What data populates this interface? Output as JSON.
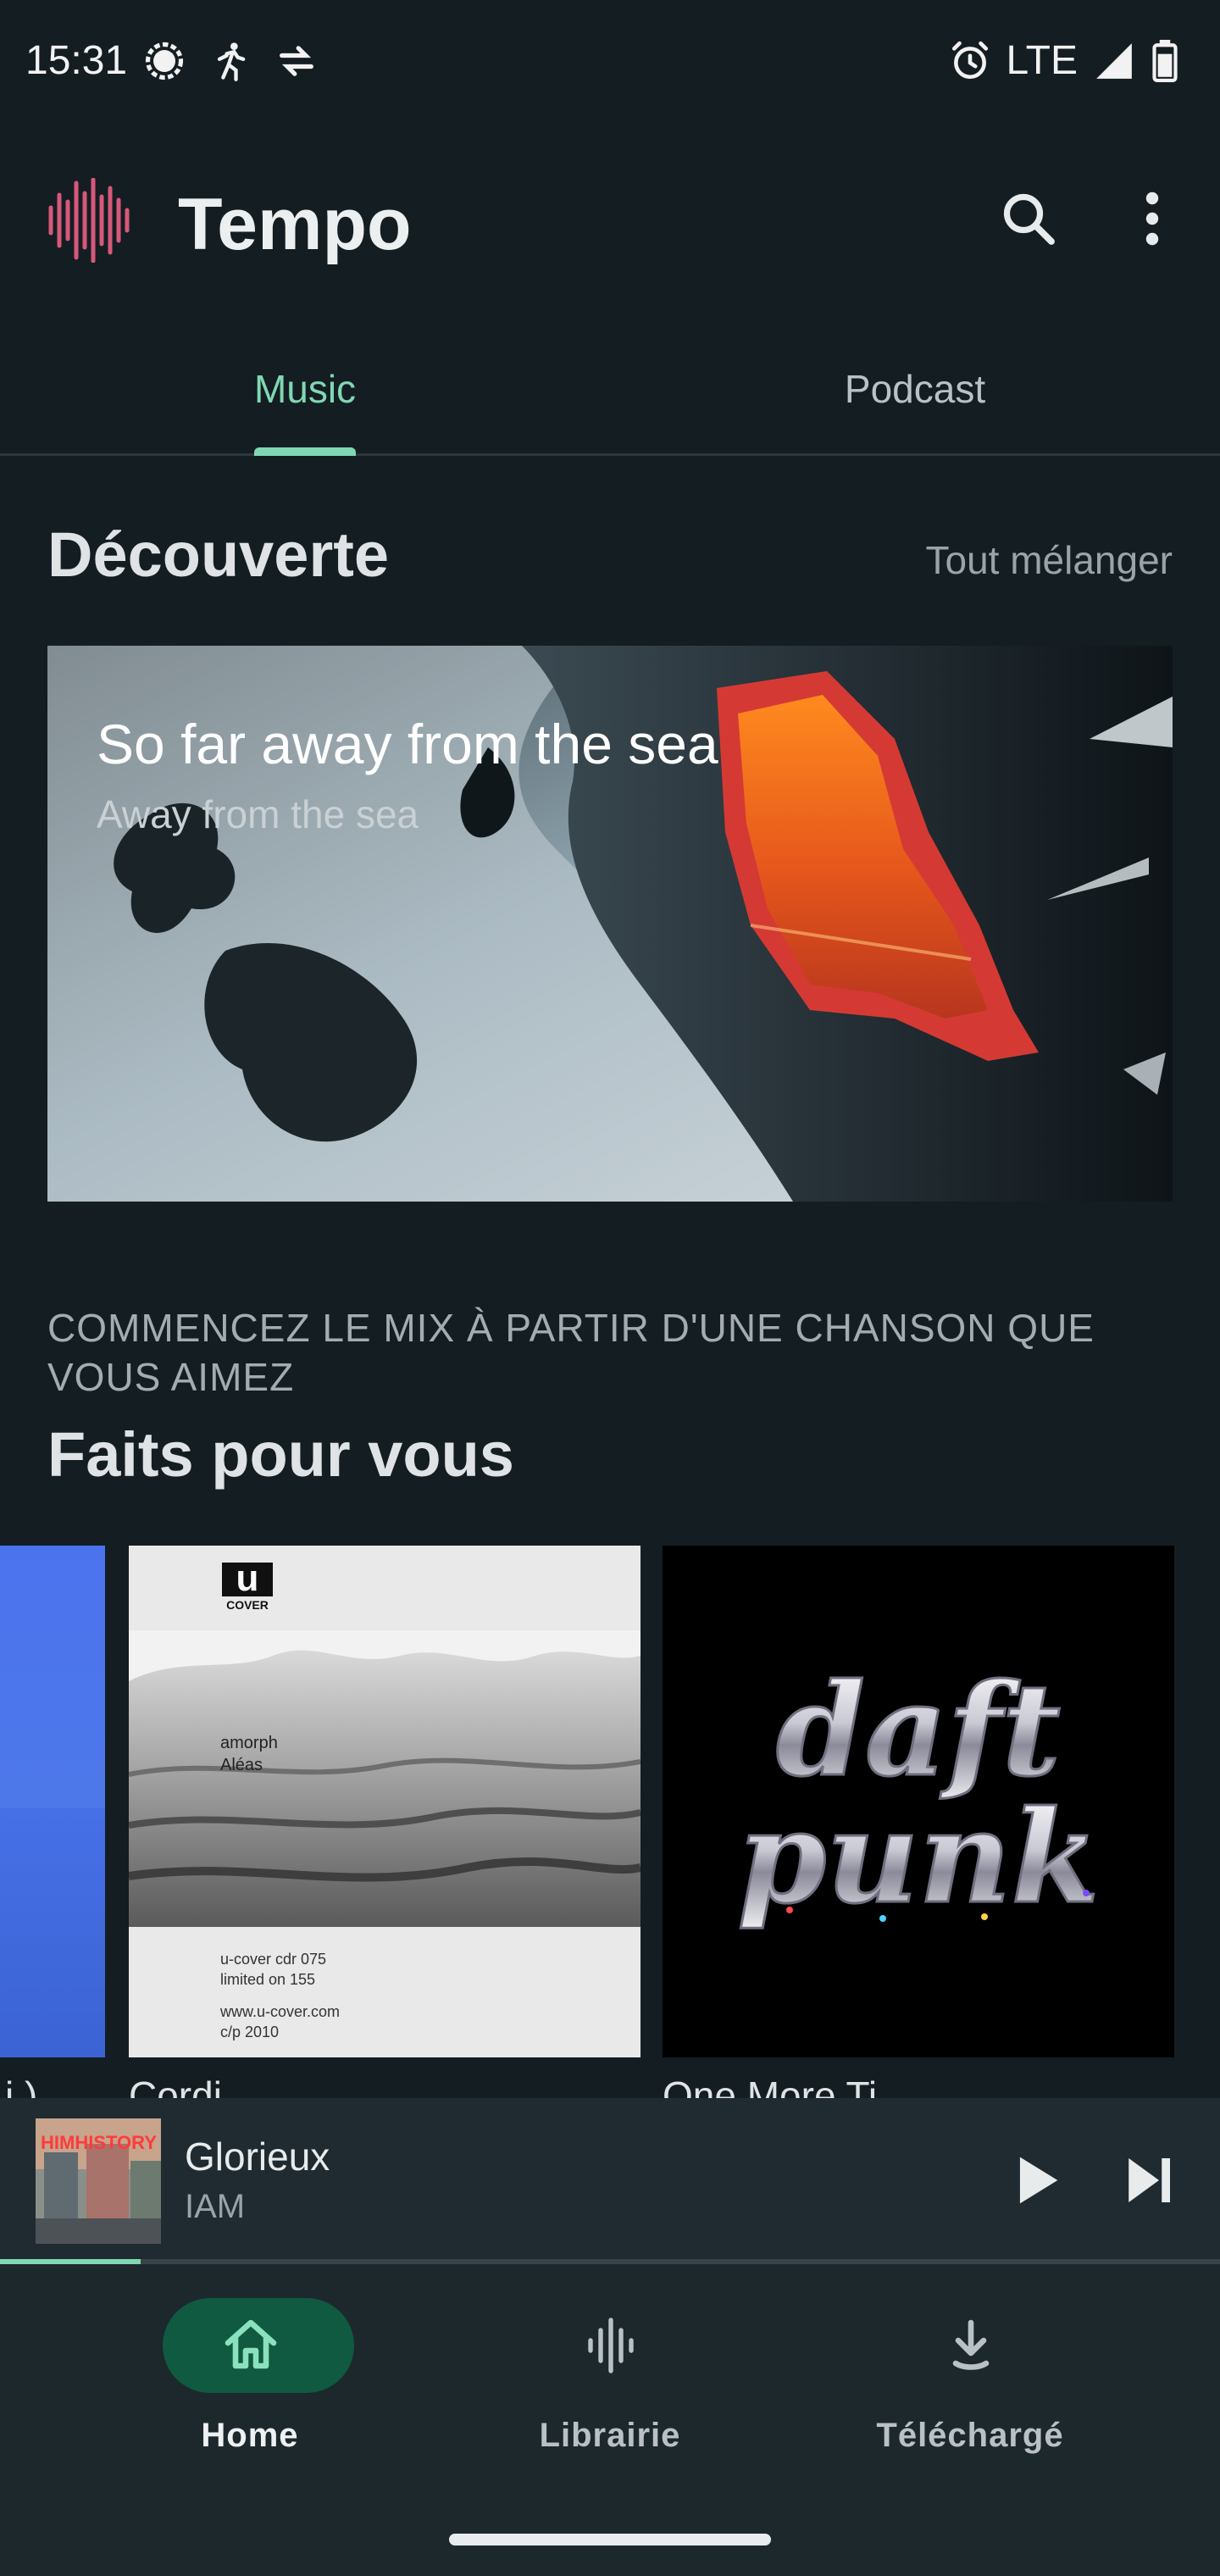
{
  "status_bar": {
    "time": "15:31",
    "network": "LTE",
    "icons": [
      "chat-bubble-icon",
      "running-icon",
      "data-transfer-icon",
      "alarm-icon",
      "signal-icon",
      "battery-icon"
    ]
  },
  "app_bar": {
    "title": "Tempo",
    "logo": "waveform-logo",
    "actions": [
      "search-icon",
      "more-vert-icon"
    ]
  },
  "tabs": [
    {
      "label": "Music",
      "selected": true
    },
    {
      "label": "Podcast",
      "selected": false
    }
  ],
  "discovery": {
    "title": "Découverte",
    "shuffle_label": "Tout mélanger",
    "featured": {
      "title": "So far away from the sea",
      "subtitle": "Away from the sea"
    }
  },
  "made_for_you": {
    "caption": "COMMENCEZ LE MIX À PARTIR D'UNE CHANSON QUE VOUS AIMEZ",
    "title": "Faits pour vous",
    "albums": [
      {
        "cover": "blue-gradient",
        "label": "i )"
      },
      {
        "cover": "u-cover",
        "label": "Cordi",
        "cover_text": {
          "brand": "u",
          "brand_sub": "COVER",
          "artist": "amorph",
          "album": "Aléas",
          "catalog": "u-cover cdr 075",
          "limited": "limited on 155",
          "site": "www.u-cover.com",
          "copyright": "c/p 2010"
        }
      },
      {
        "cover": "daft-punk",
        "label": "One More Ti",
        "cover_text": {
          "line1": "daft",
          "line2": "punk"
        }
      }
    ]
  },
  "mini_player": {
    "title": "Glorieux",
    "artist": "IAM",
    "art_text": "HIMHISTORY",
    "progress": 0.115
  },
  "bottom_nav": [
    {
      "label": "Home",
      "icon": "home-icon",
      "selected": true
    },
    {
      "label": "Librairie",
      "icon": "waveform-icon",
      "selected": false
    },
    {
      "label": "Téléchargé",
      "icon": "download-icon",
      "selected": false
    }
  ],
  "colors": {
    "background": "#141d22",
    "accent": "#7fd8b3",
    "nav_pill": "#0f5a40",
    "logo_pink": "#d6587a"
  }
}
